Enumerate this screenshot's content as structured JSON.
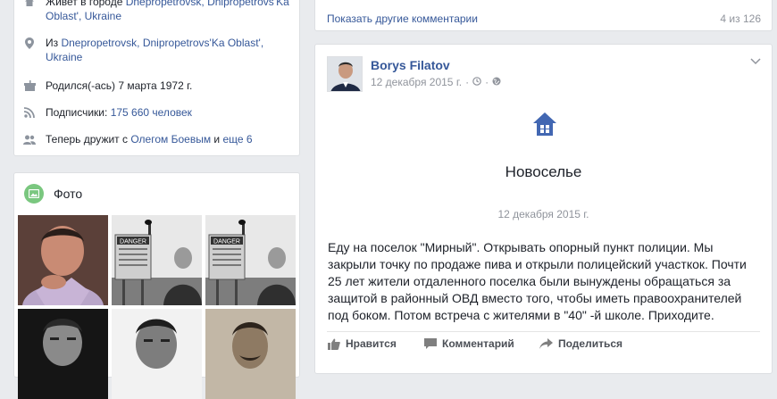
{
  "about": {
    "lives_prefix": "Живет в городе ",
    "lives_link": "Dnepropetrovsk, Dnipropetrovs'Ka Oblast', Ukraine",
    "from_prefix": "Из ",
    "from_link": "Dnepropetrovsk, Dnipropetrovs'Ka Oblast', Ukraine",
    "born": "Родился(-ась) 7 марта 1972 г.",
    "followers_prefix": "Подписчики: ",
    "followers_link": "175 660 человек",
    "friends_prefix": "Теперь дружит с ",
    "friends_link1": "Олегом Боевым",
    "friends_mid": " и ",
    "friends_link2": "еще 6"
  },
  "photos": {
    "title": "Фото",
    "items": [
      {
        "icon": "portrait-photo"
      },
      {
        "icon": "danger-sign-photo"
      },
      {
        "icon": "danger-sign-photo"
      },
      {
        "icon": "bw-portrait-photo"
      },
      {
        "icon": "bw-portrait-photo"
      },
      {
        "icon": "vintage-portrait-photo"
      }
    ]
  },
  "comments_bar": {
    "more_label": "Показать другие комментарии",
    "count": "4 из 126"
  },
  "post": {
    "author": "Borys Filatov",
    "date": "12 декабря 2015 г.",
    "event_title": "Новоселье",
    "event_date": "12 декабря 2015 г.",
    "text": "Еду на поселок \"Мирный\". Открывать опорный пункт полиции. Мы закрыли точку по продаже пива и открыли полицейский участкок. Почти 25 лет жители отдаленного поселка были вынуждены обращаться за защитой в районный ОВД вместо того, чтобы иметь правоохранителей под боком. Потом встреча с жителями в \"40\" -й школе. Приходите.",
    "actions": {
      "like": "Нравится",
      "comment": "Комментарий",
      "share": "Поделиться"
    }
  },
  "colors": {
    "link": "#365899",
    "background": "#e9ebee",
    "muted": "#90949c",
    "photo_icon": "#7ac77f"
  }
}
